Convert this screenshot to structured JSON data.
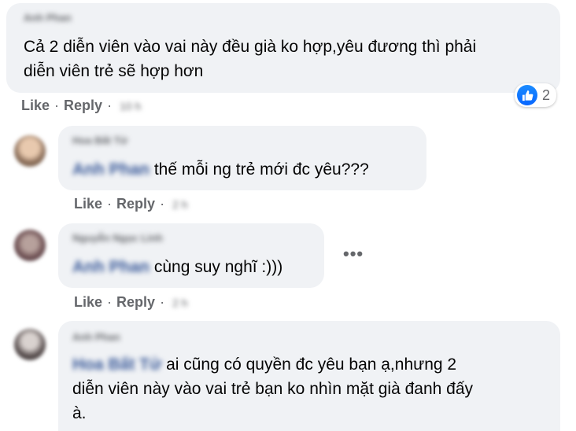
{
  "comments": [
    {
      "author": "Anh Phan",
      "text_line1": "Cả 2 diễn viên vào vai này đều già ko hợp,yêu đương thì phải",
      "text_line2": "diễn viên trẻ sẽ hợp hơn",
      "like_label": "Like",
      "reply_label": "Reply",
      "time": "10 h",
      "reaction_count": "2"
    },
    {
      "author": "Hoa Bất Tử",
      "mention": "Anh Phan",
      "text": "thế mỗi ng trẻ mới đc yêu???",
      "like_label": "Like",
      "reply_label": "Reply",
      "time": "2 h"
    },
    {
      "author": "Nguyễn Ngọc Linh",
      "mention": "Anh Phan",
      "text": "cùng suy nghĩ :)))",
      "like_label": "Like",
      "reply_label": "Reply",
      "time": "2 h",
      "more_label": "•••"
    },
    {
      "author": "Anh Phan",
      "mention": "Hoa Bất Tử",
      "text_line1": "ai cũng có quyền đc yêu bạn ạ,nhưng 2",
      "text_line2": "diễn viên này vào vai trẻ bạn ko nhìn mặt già đanh đấy",
      "text_line3": "à."
    }
  ],
  "separator": "·",
  "colors": {
    "bubble": "#f0f2f5",
    "action_text": "#65676b",
    "like_blue": "#0866ff"
  }
}
